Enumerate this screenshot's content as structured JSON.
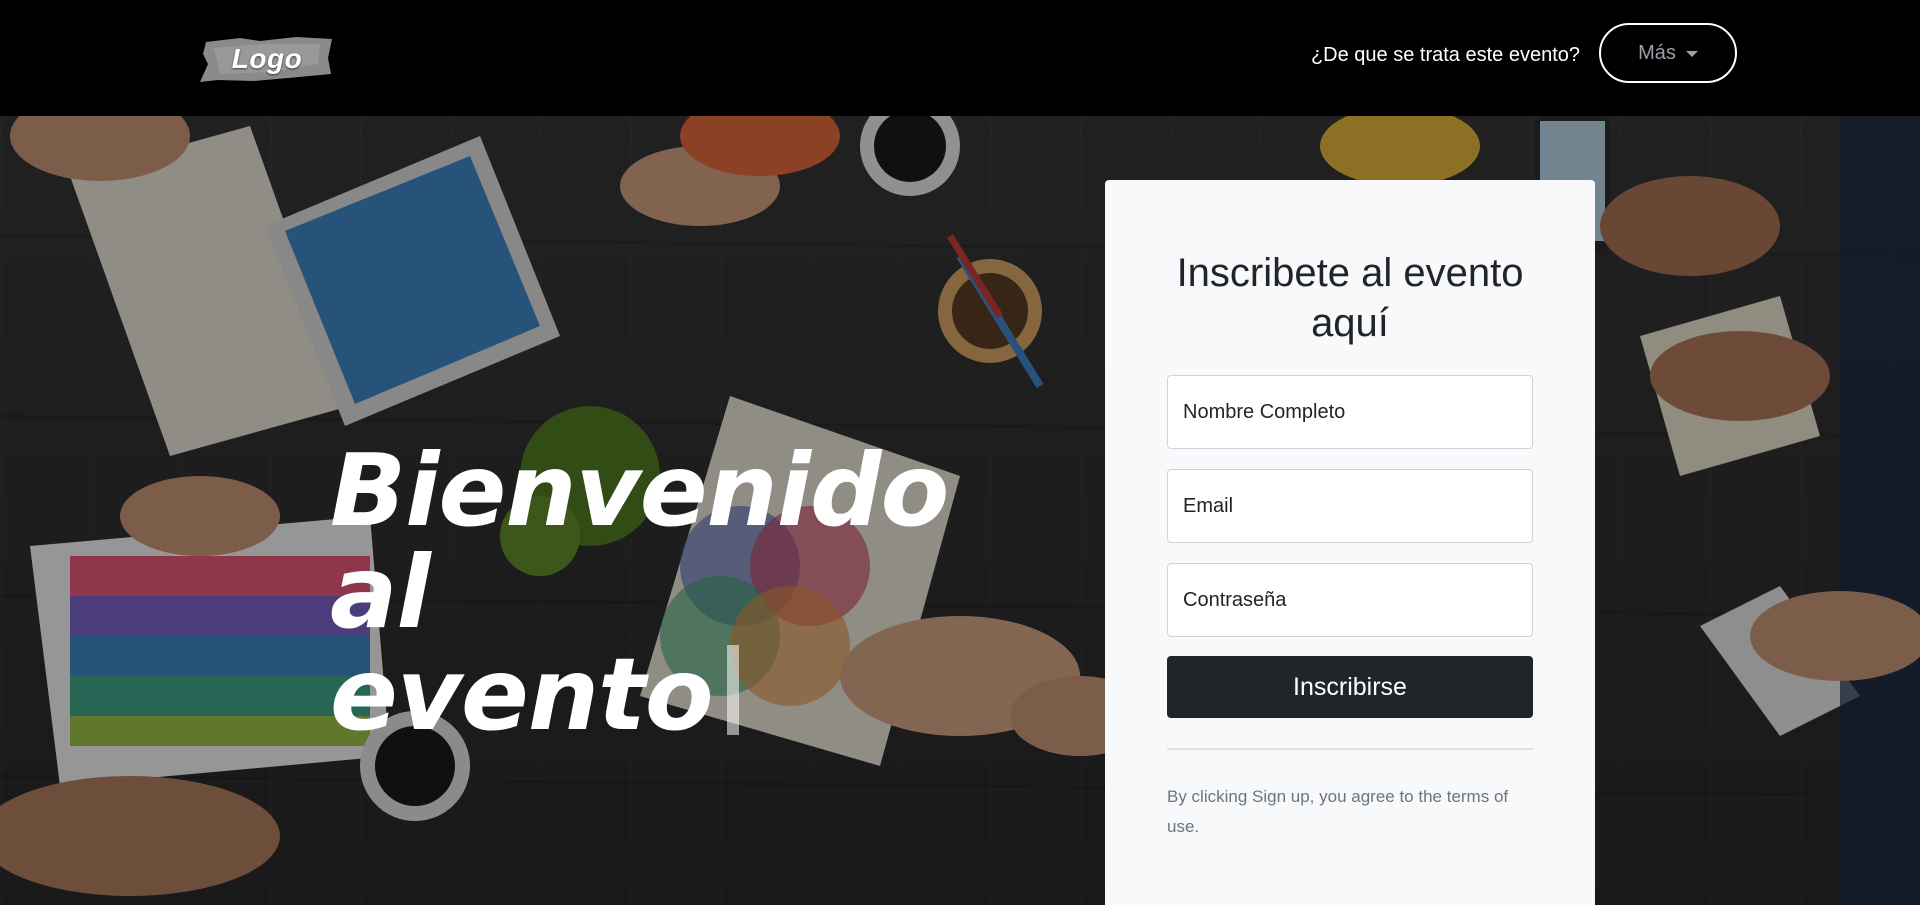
{
  "navbar": {
    "logo_text": "Logo",
    "about_link": "¿De que se trata este evento?",
    "more_button": "Más"
  },
  "hero": {
    "title_line1": "Bienvenido al",
    "title_line2": "evento"
  },
  "form": {
    "heading": "Inscribete al evento aquí",
    "name_placeholder": "Nombre Completo",
    "email_placeholder": "Email",
    "password_placeholder": "Contraseña",
    "submit_label": "Inscribirse",
    "terms_text": "By clicking Sign up, you agree to the terms of use."
  },
  "colors": {
    "navbar_bg": "#000000",
    "card_bg": "#f8f9fa",
    "button_bg": "#212529",
    "terms_text": "#6c757d"
  },
  "icons": {
    "dropdown": "caret-down-icon"
  }
}
